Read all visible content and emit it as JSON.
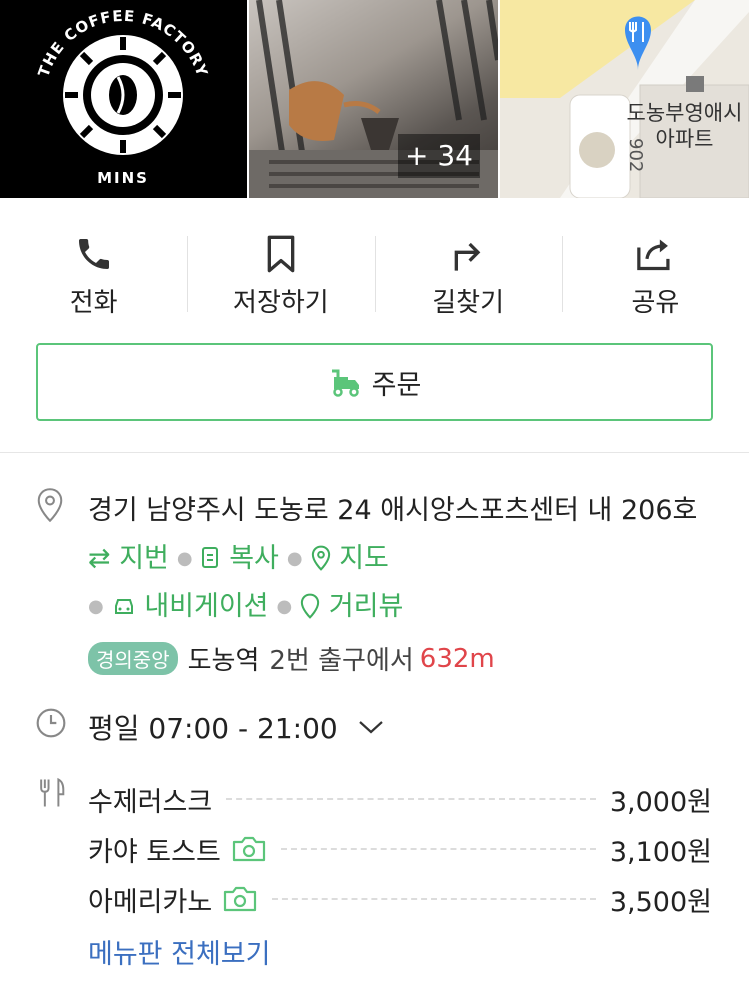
{
  "photos": {
    "logo": {
      "top_text": "THE COFFEE FACTORY",
      "bottom_text": "MINS"
    },
    "more_count": "+ 34",
    "map": {
      "building_label_line1": "도농부영애시",
      "building_label_line2": "아파트",
      "road_number": "902"
    }
  },
  "actions": {
    "call": "전화",
    "save": "저장하기",
    "directions": "길찾기",
    "share": "공유"
  },
  "order_button": "주문",
  "address": {
    "line": "경기 남양주시 도농로 24 애시앙스포츠센터 내 206호",
    "links": {
      "lot_address": "지번",
      "copy": "복사",
      "map": "지도",
      "navigation": "내비게이션",
      "street_view": "거리뷰"
    }
  },
  "subway": {
    "line": "경의중앙",
    "station": "도농역",
    "exit": "2번 출구에서",
    "distance": "632m"
  },
  "hours": {
    "text": "평일 07:00 - 21:00"
  },
  "menu": {
    "items": [
      {
        "name": "수제러스크",
        "price": "3,000원",
        "has_photo": false
      },
      {
        "name": "카야 토스트",
        "price": "3,100원",
        "has_photo": true
      },
      {
        "name": "아메리카노",
        "price": "3,500원",
        "has_photo": true
      }
    ],
    "view_all": "메뉴판 전체보기"
  },
  "colors": {
    "accent_green": "#3fae5e",
    "distance_red": "#e0454a",
    "link_blue": "#3b6fc0",
    "subway_badge": "#7dc3a8"
  }
}
